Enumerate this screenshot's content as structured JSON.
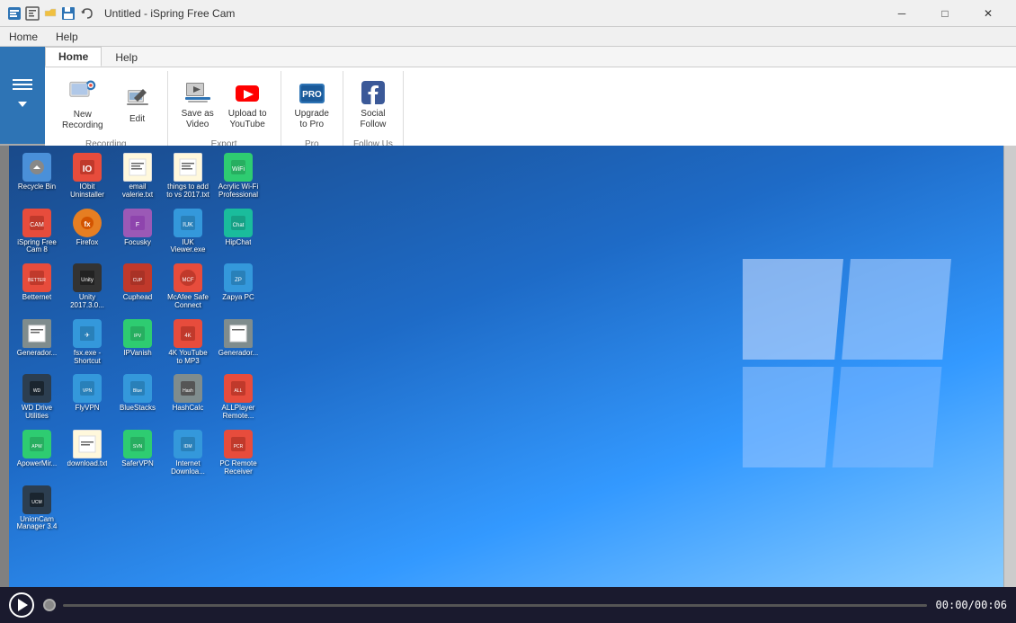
{
  "titleBar": {
    "title": "Untitled - iSpring Free Cam",
    "controls": {
      "minimize": "─",
      "maximize": "□",
      "close": "✕"
    }
  },
  "menuBar": {
    "tabs": [
      {
        "label": "Home",
        "active": true
      },
      {
        "label": "Help",
        "active": false
      }
    ]
  },
  "ribbon": {
    "groups": [
      {
        "name": "recording",
        "label": "Recording",
        "buttons": [
          {
            "id": "new-recording",
            "label": "New\nRecording",
            "icon": "film"
          },
          {
            "id": "edit",
            "label": "Edit",
            "icon": "pencil"
          }
        ]
      },
      {
        "name": "export",
        "label": "Export",
        "buttons": [
          {
            "id": "save-as-video",
            "label": "Save as\nVideo",
            "icon": "film-strip"
          },
          {
            "id": "upload-to-youtube",
            "label": "Upload to\nYouTube",
            "icon": "youtube"
          }
        ]
      },
      {
        "name": "pro",
        "label": "Pro",
        "buttons": [
          {
            "id": "upgrade-to-pro",
            "label": "Upgrade\nto Pro",
            "icon": "pro"
          }
        ]
      },
      {
        "name": "follow-us",
        "label": "Follow Us",
        "buttons": [
          {
            "id": "social",
            "label": "Social\nFollow",
            "icon": "facebook"
          }
        ]
      }
    ]
  },
  "bottomBar": {
    "timeElapsed": "00:00",
    "timeTotal": "00:06",
    "timeSeparator": "/"
  },
  "desktopIcons": [
    {
      "label": "Recycle Bin",
      "color": "#4a90d9"
    },
    {
      "label": "IObit Uninstaller",
      "color": "#e74c3c"
    },
    {
      "label": "email valerie.txt",
      "color": "#f39c12"
    },
    {
      "label": "things to add to vs 2017.txt",
      "color": "#3498db"
    },
    {
      "label": "Acrylic Wi-Fi Professional",
      "color": "#2ecc71"
    },
    {
      "label": "iSpring Free Cam 8",
      "color": "#e74c3c"
    },
    {
      "label": "Firefox",
      "color": "#e67e22"
    },
    {
      "label": "Focusky",
      "color": "#9b59b6"
    },
    {
      "label": "IUK Viewer.exe",
      "color": "#3498db"
    },
    {
      "label": "HipChat",
      "color": "#1abc9c"
    },
    {
      "label": "Betternet",
      "color": "#e74c3c"
    },
    {
      "label": "Unity 2017.3.0...",
      "color": "#333"
    },
    {
      "label": "Cuphead",
      "color": "#c0392b"
    },
    {
      "label": "McAfee Safe Connect",
      "color": "#e74c3c"
    },
    {
      "label": "Zapya PC",
      "color": "#3498db"
    },
    {
      "label": "Generador...",
      "color": "#7f8c8d"
    },
    {
      "label": "fsx.exe - Shortcut",
      "color": "#3498db"
    },
    {
      "label": "IPVanish",
      "color": "#2ecc71"
    },
    {
      "label": "4K YouTube to MP3",
      "color": "#e74c3c"
    },
    {
      "label": "Generador...",
      "color": "#7f8c8d"
    },
    {
      "label": "WD Drive Utilities",
      "color": "#2c3e50"
    },
    {
      "label": "FlyVPN",
      "color": "#3498db"
    },
    {
      "label": "BlueStacks",
      "color": "#3498db"
    },
    {
      "label": "HashCalc",
      "color": "#7f8c8d"
    },
    {
      "label": "ALLPlayer Remote...",
      "color": "#e74c3c"
    },
    {
      "label": "ApowerMir...",
      "color": "#2ecc71"
    },
    {
      "label": "download.txt",
      "color": "#7f8c8d"
    },
    {
      "label": "SaferVPN",
      "color": "#2ecc71"
    },
    {
      "label": "Internet Downloa...",
      "color": "#3498db"
    },
    {
      "label": "PC Remote Receiver",
      "color": "#e74c3c"
    },
    {
      "label": "UnionCam Manager 3.4",
      "color": "#2c3e50"
    }
  ]
}
